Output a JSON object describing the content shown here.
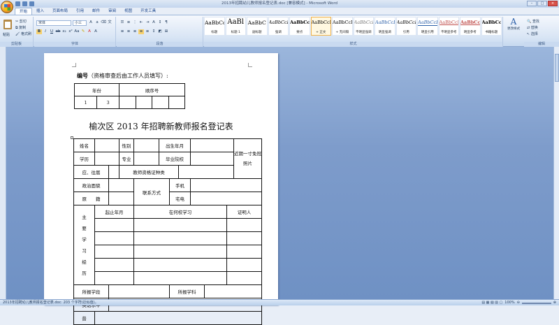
{
  "window": {
    "title": "2013年招聘幼儿教师报名登记表.doc [兼容模式] - Microsoft Word"
  },
  "tabs": [
    "开始",
    "插入",
    "页面布局",
    "引用",
    "邮件",
    "审阅",
    "视图",
    "开发工具"
  ],
  "clipboard": {
    "paste": "粘贴",
    "cut": "剪切",
    "copy": "复制",
    "format_painter": "格式刷",
    "group": "剪贴板"
  },
  "font": {
    "name": "宋体",
    "size": "小三",
    "group": "字体"
  },
  "paragraph": {
    "group": "段落"
  },
  "styles": {
    "group": "样式",
    "items": [
      {
        "sample": "AaBbCc",
        "name": "标题"
      },
      {
        "sample": "AaBl",
        "name": "标题 1"
      },
      {
        "sample": "AaBbC",
        "name": "副标题"
      },
      {
        "sample": "AaBbCcDt",
        "name": "强调"
      },
      {
        "sample": "AaBbCcD",
        "name": "要点"
      },
      {
        "sample": "AaBbCcDt",
        "name": "+ 正文"
      },
      {
        "sample": "AaBbCcDc",
        "name": "+ 无间隔"
      },
      {
        "sample": "AaBbCcDt",
        "name": "不明显强调"
      },
      {
        "sample": "AaBbCcDt",
        "name": "明显强调"
      },
      {
        "sample": "AaBbCcDt",
        "name": "引用"
      },
      {
        "sample": "AaBbCcDt",
        "name": "明显引用"
      },
      {
        "sample": "AaBbCcD",
        "name": "不明显参考"
      },
      {
        "sample": "AaBbCcD",
        "name": "明显参考"
      },
      {
        "sample": "AaBbCcI",
        "name": "书籍标题"
      }
    ],
    "change": "更改样式"
  },
  "editing": {
    "find": "查找",
    "replace": "替换",
    "select": "选择",
    "group": "编辑"
  },
  "document": {
    "header_bold": "编号",
    "header_rest": "（资格审查后由工作人员填写）:",
    "t1": {
      "year": "年份",
      "seq": "顺序号",
      "v1": "1",
      "v2": "3"
    },
    "title": "榆次区 2013 年招聘新教师报名登记表",
    "form": {
      "name": "姓名",
      "gender": "性别",
      "birth": "出生年月",
      "photo": "近期一寸免冠照片",
      "edu": "学历",
      "major": "专业",
      "school": "毕业院校",
      "grad": "应、往届",
      "cert": "教师资格证种类",
      "politics": "政治面貌",
      "contact": "联系方式",
      "mobile": "手机",
      "origin": "原　　籍",
      "home": "宅电",
      "chars": [
        "主",
        "要",
        "学",
        "习",
        "经",
        "历"
      ],
      "period": "起止年月",
      "where": "在何校学习",
      "witness": "证明人",
      "apply_section": "所报学段",
      "apply_subject": "所报学科",
      "english": "英语水平",
      "last": "普"
    }
  },
  "status": {
    "text": "2013年招聘幼儿教师报名登记表.doc: 203 个字符(近似值)。",
    "zoom": "100%"
  }
}
